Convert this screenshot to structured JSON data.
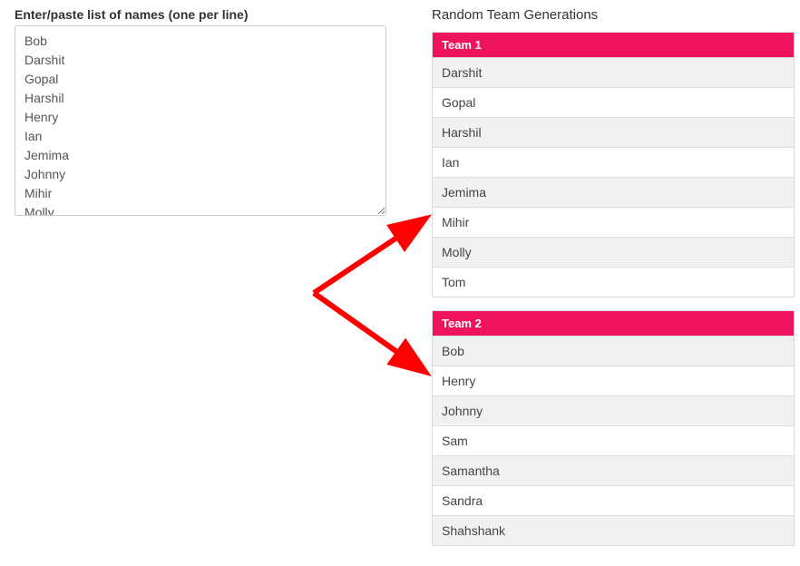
{
  "input": {
    "label": "Enter/paste list of names (one per line)",
    "names": [
      "Bob",
      "Darshit",
      "Gopal",
      "Harshil",
      "Henry",
      "Ian",
      "Jemima",
      "Johnny",
      "Mihir",
      "Molly"
    ]
  },
  "results": {
    "heading": "Random Team Generations",
    "teams": [
      {
        "name": "Team 1",
        "members": [
          "Darshit",
          "Gopal",
          "Harshil",
          "Ian",
          "Jemima",
          "Mihir",
          "Molly",
          "Tom"
        ]
      },
      {
        "name": "Team 2",
        "members": [
          "Bob",
          "Henry",
          "Johnny",
          "Sam",
          "Samantha",
          "Sandra",
          "Shahshank"
        ]
      }
    ]
  },
  "colors": {
    "team_header_bg": "#ed145b",
    "arrow": "#ff0000"
  }
}
